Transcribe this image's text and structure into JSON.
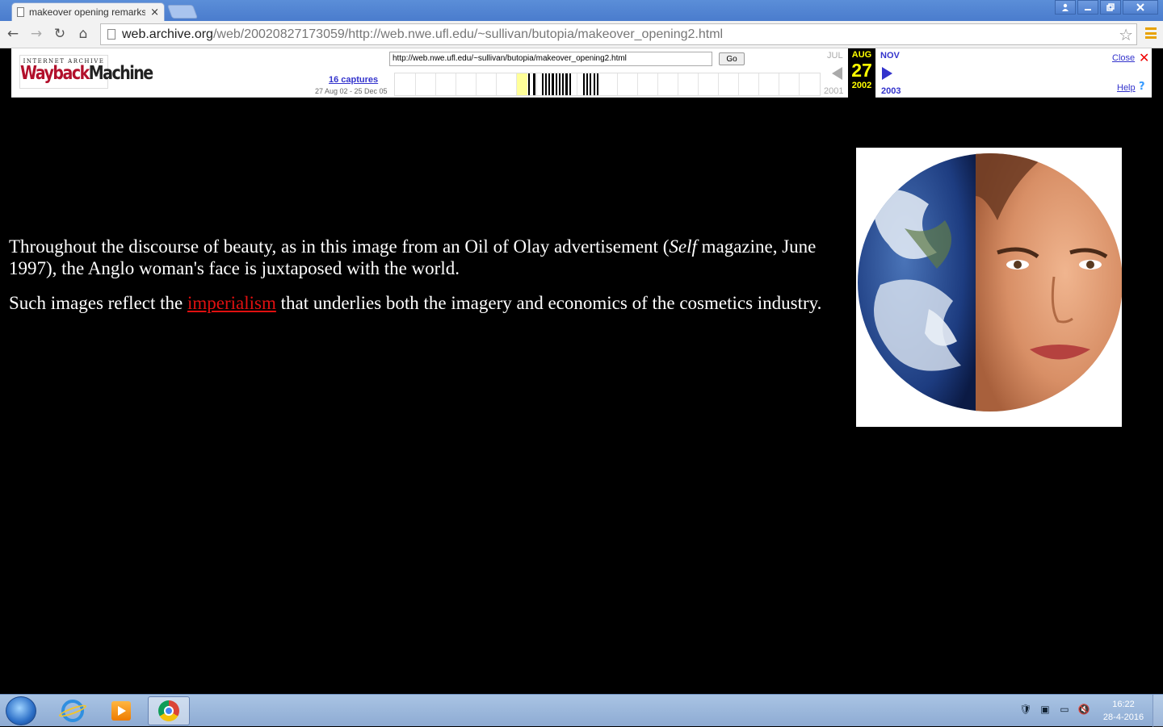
{
  "browser": {
    "tab_title": "makeover opening remarks",
    "tab_close": "×",
    "url_host": "web.archive.org",
    "url_path": "/web/20020827173059/http://web.nwe.ufl.edu/~sullivan/butopia/makeover_opening2.html",
    "back": "←",
    "forward": "→",
    "reload": "↻",
    "home": "⌂",
    "star": "☆",
    "icons": [
      "page-icon",
      "back-icon",
      "forward-icon",
      "reload-icon",
      "home-icon",
      "star-icon",
      "menu-icon",
      "minimize-icon",
      "restore-icon",
      "close-icon",
      "user-icon"
    ]
  },
  "wayback": {
    "logo_top": "INTERNET ARCHIVE",
    "logo_wayback": "Wayback",
    "logo_machine": "Machine",
    "url_value": "http://web.nwe.ufl.edu/~sullivan/butopia/makeover_opening2.html",
    "go_label": "Go",
    "captures": "16 captures",
    "range": "27 Aug 02 - 25 Dec 05",
    "prev_month": "JUL",
    "prev_year": "2001",
    "cur_month": "AUG",
    "cur_day": "27",
    "cur_year": "2002",
    "next_month": "NOV",
    "next_year": "2003",
    "close_label": "Close",
    "help_label": "Help"
  },
  "page": {
    "p1_before": "Throughout the discourse of beauty, as in this image from an Oil of Olay advertisement (",
    "p1_italic": "Self",
    "p1_after": " magazine, June 1997), the Anglo woman's face is juxtaposed with the world.",
    "p2_before": "Such images reflect the ",
    "p2_link": "imperialism",
    "p2_after": " that underlies both the imagery and economics of the cosmetics industry."
  },
  "taskbar": {
    "time": "16:22",
    "date": "28-4-2016",
    "icons": [
      "start-icon",
      "internet-explorer-icon",
      "media-player-icon",
      "chrome-icon",
      "shield-icon",
      "network-icon",
      "display-icon",
      "volume-muted-icon"
    ]
  },
  "colors": {
    "accent_link": "#e01010",
    "wayback_blue": "#33c",
    "wayback_yellow": "#ffff00"
  }
}
